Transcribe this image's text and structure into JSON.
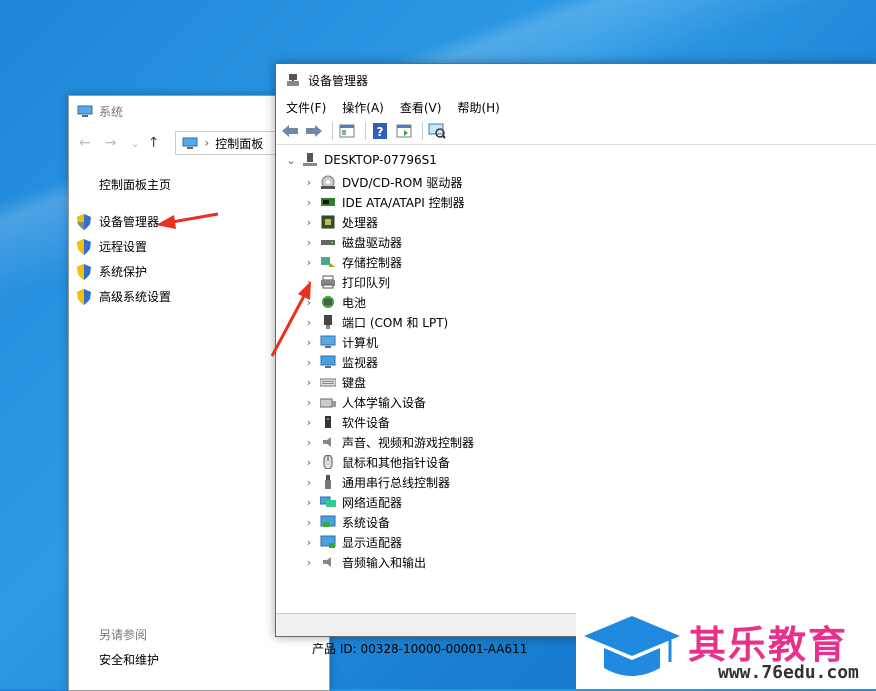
{
  "system_window": {
    "title": "系统",
    "nav": {
      "back": "←",
      "forward": "→",
      "dropdown": "⌄",
      "up": "↑"
    },
    "address": "控制面板",
    "home_link": "控制面板主页",
    "links": [
      "设备管理器",
      "远程设置",
      "系统保护",
      "高级系统设置"
    ],
    "see_also": "另请参阅",
    "safety_link": "安全和维护"
  },
  "device_manager": {
    "title": "设备管理器",
    "menu": [
      "文件(F)",
      "操作(A)",
      "查看(V)",
      "帮助(H)"
    ],
    "root": "DESKTOP-07796S1",
    "categories": [
      {
        "label": "DVD/CD-ROM 驱动器",
        "icon": "dvd-icon"
      },
      {
        "label": "IDE ATA/ATAPI 控制器",
        "icon": "ide-icon"
      },
      {
        "label": "处理器",
        "icon": "cpu-icon"
      },
      {
        "label": "磁盘驱动器",
        "icon": "disk-icon"
      },
      {
        "label": "存储控制器",
        "icon": "storage-icon"
      },
      {
        "label": "打印队列",
        "icon": "printer-icon"
      },
      {
        "label": "电池",
        "icon": "battery-icon"
      },
      {
        "label": "端口 (COM 和 LPT)",
        "icon": "port-icon"
      },
      {
        "label": "计算机",
        "icon": "computer-icon"
      },
      {
        "label": "监视器",
        "icon": "monitor-icon"
      },
      {
        "label": "键盘",
        "icon": "keyboard-icon"
      },
      {
        "label": "人体学输入设备",
        "icon": "hid-icon"
      },
      {
        "label": "软件设备",
        "icon": "software-icon"
      },
      {
        "label": "声音、视频和游戏控制器",
        "icon": "sound-icon"
      },
      {
        "label": "鼠标和其他指针设备",
        "icon": "mouse-icon"
      },
      {
        "label": "通用串行总线控制器",
        "icon": "usb-icon"
      },
      {
        "label": "网络适配器",
        "icon": "network-icon"
      },
      {
        "label": "系统设备",
        "icon": "system-device-icon"
      },
      {
        "label": "显示适配器",
        "icon": "display-adapter-icon"
      },
      {
        "label": "音频输入和输出",
        "icon": "audio-icon"
      }
    ]
  },
  "product_id": "产品 ID: 00328-10000-00001-AA611",
  "brand": {
    "name": "其乐教育",
    "url": "www.76edu.com"
  },
  "colors": {
    "arrow": "#e8311f",
    "brand_pink": "#e8318b",
    "cap_blue": "#1f8ae0",
    "desktop": "#1f86d8"
  }
}
